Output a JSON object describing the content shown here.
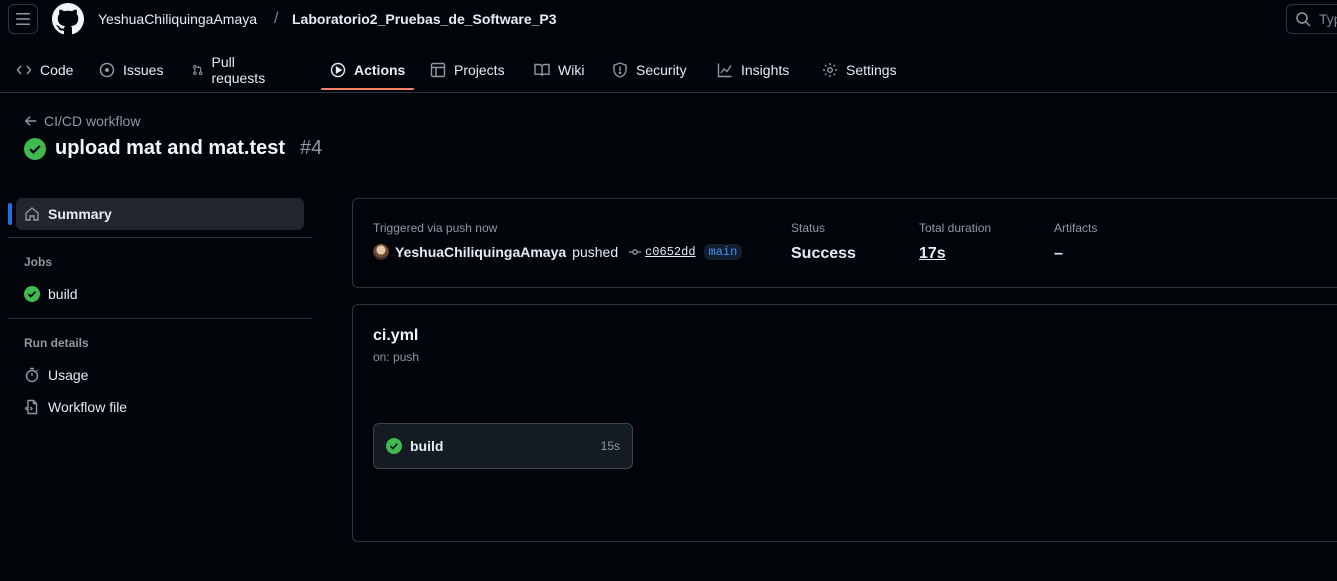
{
  "header": {
    "owner": "YeshuaChiliquingaAmaya",
    "separator": "/",
    "repo": "Laboratorio2_Pruebas_de_Software_P3",
    "search_placeholder": "Typ"
  },
  "nav": [
    {
      "label": "Code",
      "icon": "code-icon"
    },
    {
      "label": "Issues",
      "icon": "issue-icon"
    },
    {
      "label": "Pull requests",
      "icon": "pull-request-icon"
    },
    {
      "label": "Actions",
      "icon": "play-icon",
      "active": true
    },
    {
      "label": "Projects",
      "icon": "table-icon"
    },
    {
      "label": "Wiki",
      "icon": "book-icon"
    },
    {
      "label": "Security",
      "icon": "shield-icon"
    },
    {
      "label": "Insights",
      "icon": "graph-icon"
    },
    {
      "label": "Settings",
      "icon": "gear-icon"
    }
  ],
  "run": {
    "back_label": "CI/CD workflow",
    "title": "upload mat and mat.test",
    "number": "#4"
  },
  "sidebar": {
    "summary": "Summary",
    "jobs_heading": "Jobs",
    "jobs": [
      {
        "label": "build"
      }
    ],
    "run_details_heading": "Run details",
    "details": [
      {
        "label": "Usage"
      },
      {
        "label": "Workflow file"
      }
    ]
  },
  "summary": {
    "trigger_label": "Triggered via push now",
    "actor": "YeshuaChiliquingaAmaya",
    "action": "pushed",
    "sha": "c0652dd",
    "branch": "main",
    "status_label": "Status",
    "status_value": "Success",
    "duration_label": "Total duration",
    "duration_value": "17s",
    "artifacts_label": "Artifacts",
    "artifacts_value": "–"
  },
  "workflow": {
    "name": "ci.yml",
    "on": "on: push",
    "job": {
      "name": "build",
      "duration": "15s"
    }
  },
  "colors": {
    "success": "#3fb950",
    "accent": "#f78166",
    "link": "#4493f8"
  }
}
